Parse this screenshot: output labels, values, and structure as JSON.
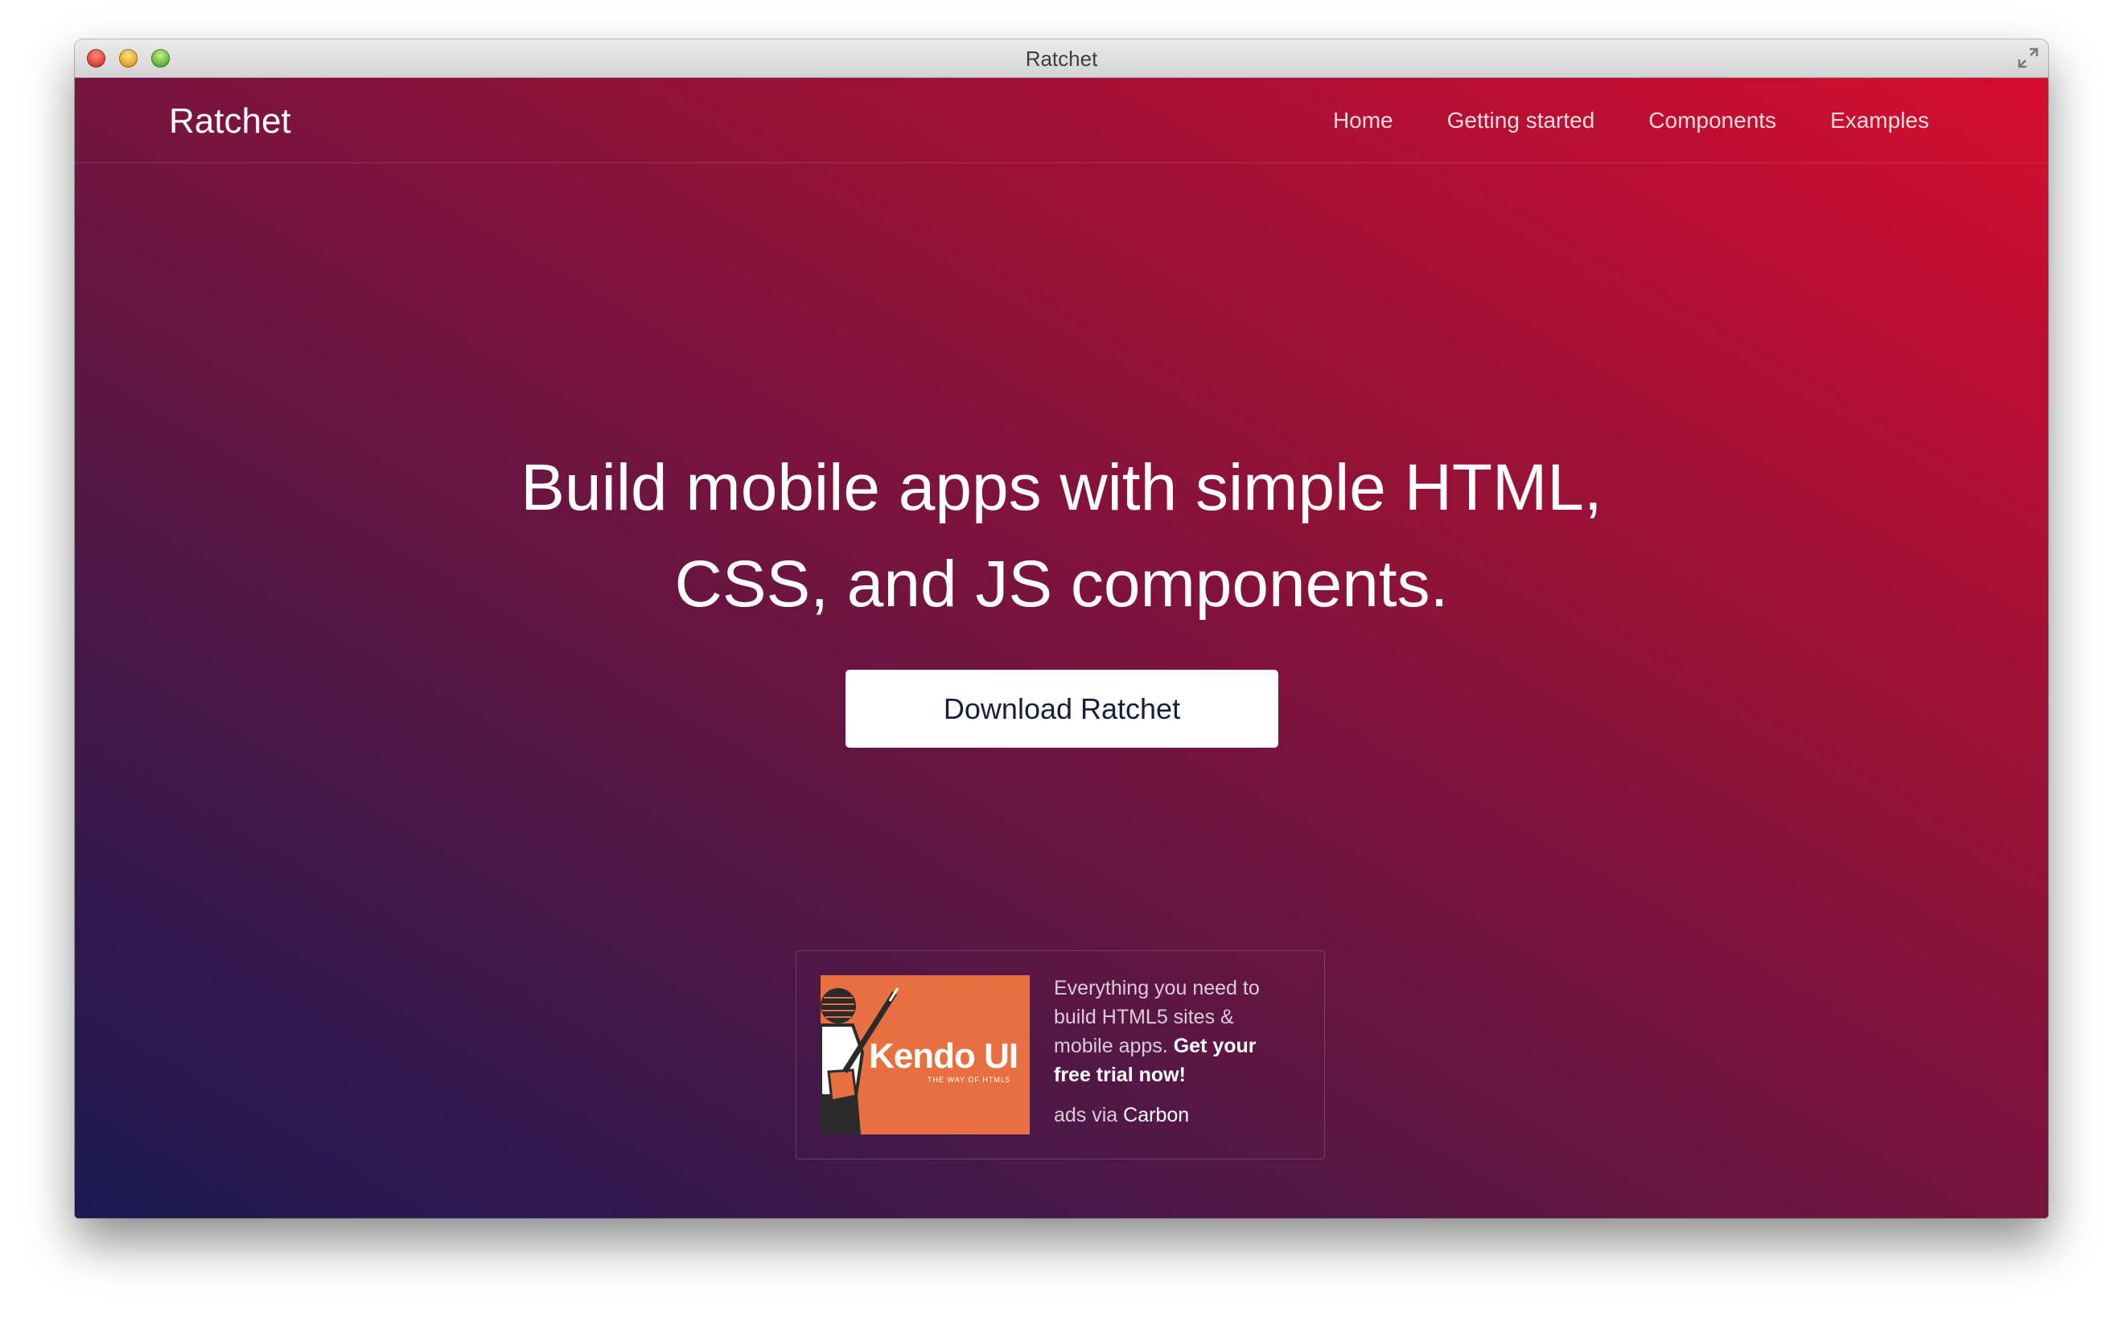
{
  "window": {
    "title": "Ratchet"
  },
  "navbar": {
    "brand": "Ratchet",
    "links": [
      {
        "label": "Home"
      },
      {
        "label": "Getting started"
      },
      {
        "label": "Components"
      },
      {
        "label": "Examples"
      }
    ]
  },
  "hero": {
    "headline_line1": "Build mobile apps with simple HTML,",
    "headline_line2": "CSS, and JS components.",
    "download_label": "Download Ratchet"
  },
  "ad": {
    "image_logo_text": "Kendo UI",
    "image_tagline": "THE WAY OF HTML5",
    "text_plain": "Everything you need to build HTML5 sites & mobile apps. ",
    "text_bold": "Get your free trial now!",
    "via_prefix": "ads via ",
    "via_link": "Carbon"
  },
  "colors": {
    "gradient_start": "#1b1953",
    "gradient_end": "#d40d2e",
    "button_text": "#1b1d40"
  }
}
